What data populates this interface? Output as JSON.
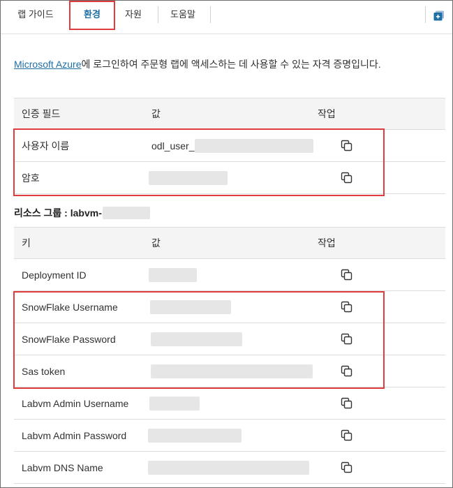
{
  "tabs": [
    {
      "label": "랩 가이드"
    },
    {
      "label": "환경"
    },
    {
      "label": "자원"
    },
    {
      "label": "도움말"
    }
  ],
  "intro": {
    "link_text": "Microsoft Azure",
    "text": "에 로그인하여 주문형 랩에 액세스하는 데 사용할 수 있는 자격 증명입니다."
  },
  "credentials": {
    "headers": {
      "field": "인증 필드",
      "value": "값",
      "action": "작업"
    },
    "rows": [
      {
        "label": "사용자 이름",
        "value_prefix": "odl_user_"
      },
      {
        "label": "암호",
        "value_prefix": ""
      }
    ]
  },
  "resource_group": {
    "label": "리소스 그룹 : labvm-"
  },
  "keys": {
    "headers": {
      "key": "키",
      "value": "값",
      "action": "작업"
    },
    "rows": [
      {
        "label": "Deployment ID"
      },
      {
        "label": "SnowFlake Username"
      },
      {
        "label": "SnowFlake Password"
      },
      {
        "label": "Sas token"
      },
      {
        "label": "Labvm Admin Username"
      },
      {
        "label": "Labvm Admin Password"
      },
      {
        "label": "Labvm DNS Name"
      }
    ]
  },
  "colors": {
    "accent": "#1d6fa5",
    "highlight": "#e03c3c"
  }
}
